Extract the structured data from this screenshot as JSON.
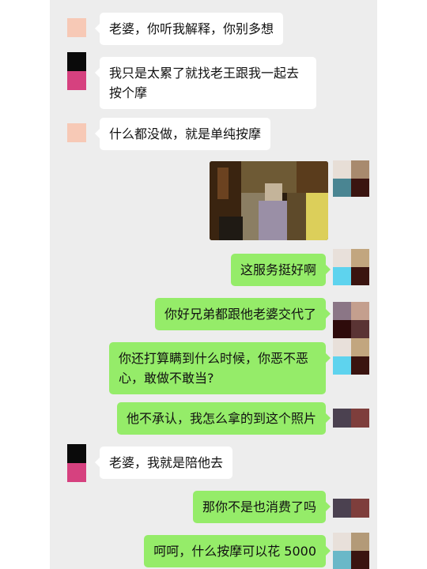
{
  "messages": [
    {
      "side": "left",
      "text": "老婆，你听我解释，你别多想"
    },
    {
      "side": "left",
      "text": "我只是太累了就找老王跟我一起去按个摩"
    },
    {
      "side": "left",
      "text": "什么都没做，就是单纯按摩"
    },
    {
      "side": "right",
      "type": "image",
      "text": ""
    },
    {
      "side": "right",
      "text": "这服务挺好啊"
    },
    {
      "side": "right",
      "text": "你好兄弟都跟他老婆交代了"
    },
    {
      "side": "right",
      "text": "你还打算瞒到什么时候，你恶不恶心，敢做不敢当?"
    },
    {
      "side": "right",
      "text": "他不承认，我怎么拿的到这个照片"
    },
    {
      "side": "left",
      "text": "老婆，我就是陪他去"
    },
    {
      "side": "right",
      "text": "那你不是也消费了吗"
    },
    {
      "side": "right",
      "text": "呵呵，什么按摩可以花 5000"
    }
  ],
  "colors": {
    "chat_background": "#ededed",
    "incoming_bubble": "#ffffff",
    "outgoing_bubble": "#95ec69",
    "text": "#111111"
  },
  "icons": {
    "left_avatar": "mosaic-avatar",
    "right_avatar": "mosaic-avatar"
  }
}
